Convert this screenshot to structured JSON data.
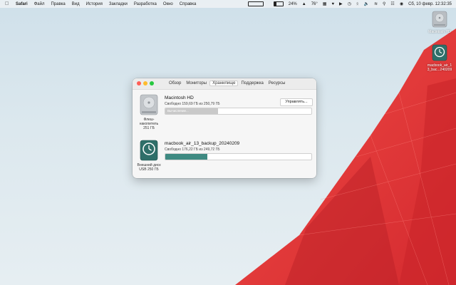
{
  "menubar": {
    "app_name": "Safari",
    "items": [
      "Файл",
      "Правка",
      "Вид",
      "История",
      "Закладки",
      "Разработка",
      "Окно",
      "Справка"
    ],
    "battery_percent": "24%",
    "temperature": "76°",
    "datetime": "Сб, 10 февр.  12:32:35"
  },
  "desktop": {
    "icons": [
      {
        "label": "Macintosh HD"
      },
      {
        "label": "macbook_air_1\n3_bac...240209"
      }
    ]
  },
  "window": {
    "tabs": [
      "Обзор",
      "Мониторы",
      "Хранилище",
      "Поддержка",
      "Ресурсы"
    ],
    "active_tab": "Хранилище",
    "disks": [
      {
        "name": "Macintosh HD",
        "free_text": "Свободно 159,69 ГБ из 250,79 ГБ",
        "bar_label": "Вычисление...",
        "fill_fraction": 0.36,
        "fill_color": "#c9c9c9",
        "caption": "Флеш-\nнакопитель\n251 ГБ",
        "manage_label": "Управлять..."
      },
      {
        "name": "macbook_air_13_backup_20240209",
        "free_text": "Свободно 176,22 ГБ из 249,72 ГБ",
        "bar_label": "",
        "fill_fraction": 0.29,
        "fill_color": "#3e8a82",
        "caption": "Внешний диск\nUSB 250 ГБ"
      }
    ]
  },
  "colors": {
    "close": "#ff5f57",
    "minimize": "#febc2e",
    "zoom": "#28c840",
    "wallpaper_red": "#e8383a",
    "backup_teal": "#3e8a82"
  }
}
